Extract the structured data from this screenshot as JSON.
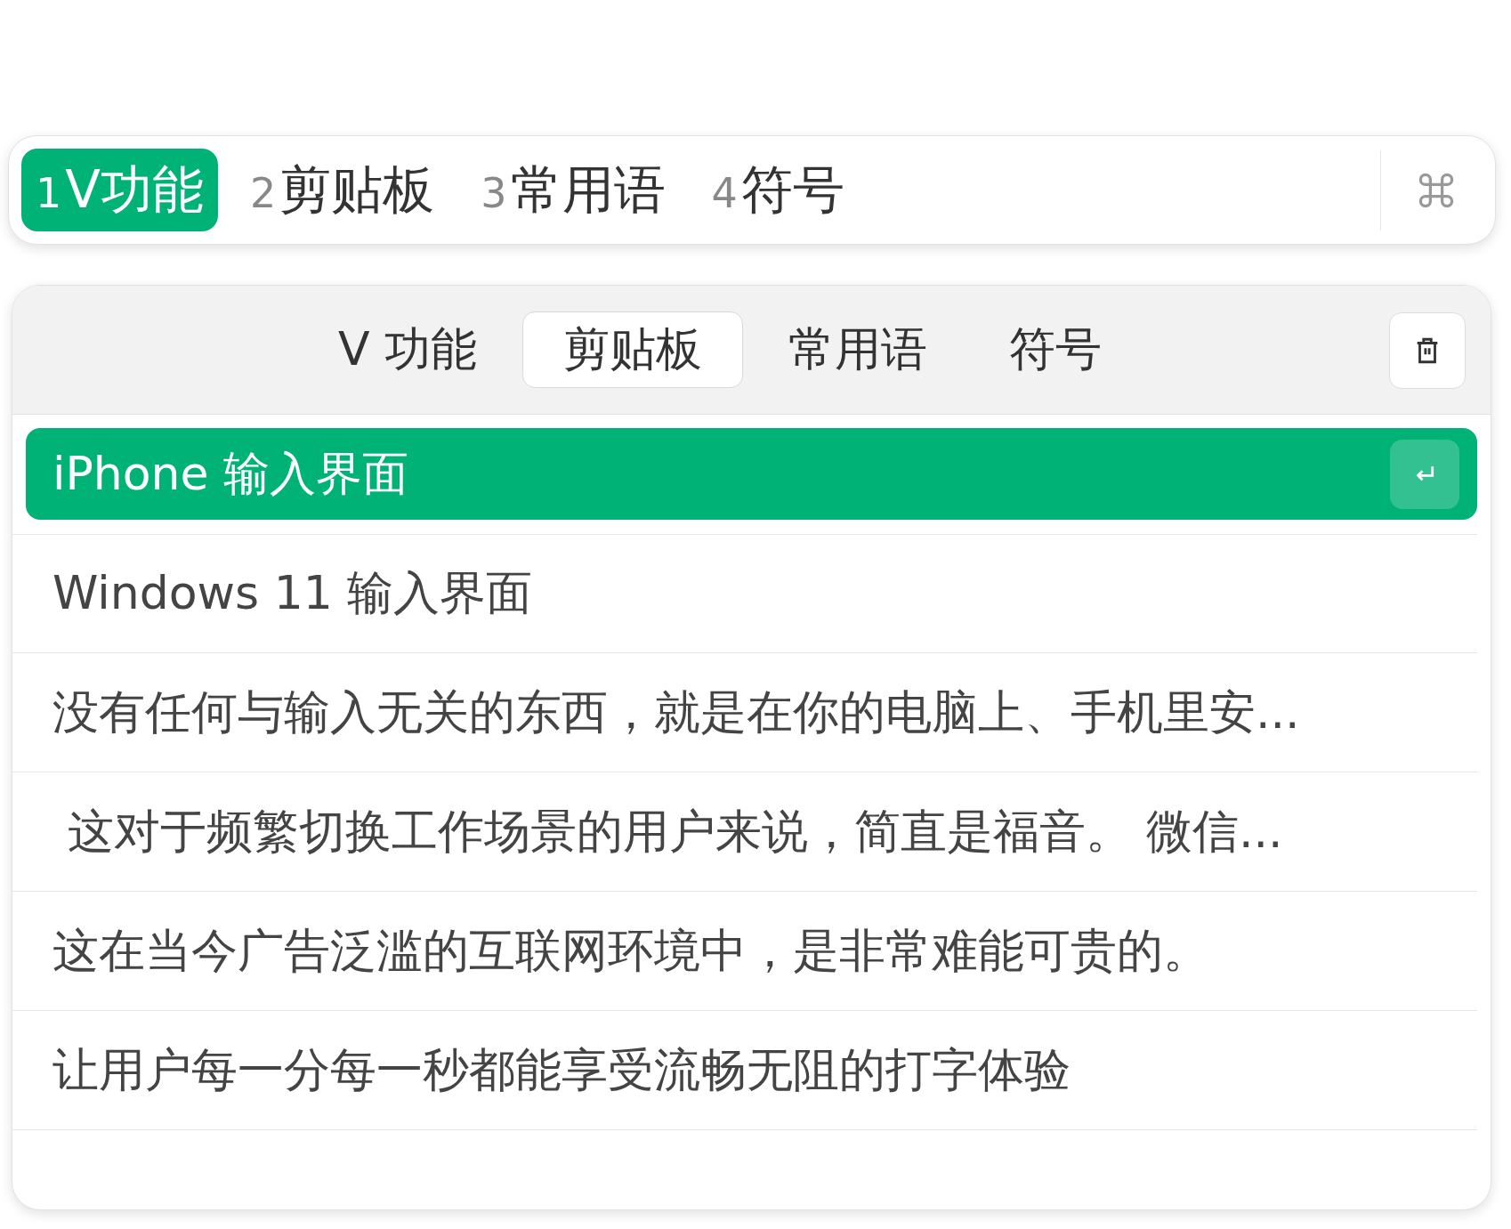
{
  "top_tabs": [
    {
      "number": "1",
      "label": "V功能",
      "selected": true
    },
    {
      "number": "2",
      "label": "剪贴板",
      "selected": false
    },
    {
      "number": "3",
      "label": "常用语",
      "selected": false
    },
    {
      "number": "4",
      "label": "符号",
      "selected": false
    }
  ],
  "panel_tabs": [
    {
      "label": "V 功能",
      "selected": false
    },
    {
      "label": "剪贴板",
      "selected": true
    },
    {
      "label": "常用语",
      "selected": false
    },
    {
      "label": "符号",
      "selected": false
    }
  ],
  "items": [
    {
      "text": "iPhone 输入界面",
      "selected": true
    },
    {
      "text": "Windows 11 输入界面",
      "selected": false
    },
    {
      "text": "没有任何与输入无关的东西，就是在你的电脑上、手机里安...",
      "selected": false
    },
    {
      "text": " 这对于频繁切换工作场景的用户来说，简直是福音。 微信...",
      "selected": false
    },
    {
      "text": "这在当今广告泛滥的互联网环境中，是非常难能可贵的。",
      "selected": false
    },
    {
      "text": "让用户每一分每一秒都能享受流畅无阻的打字体验",
      "selected": false
    }
  ]
}
